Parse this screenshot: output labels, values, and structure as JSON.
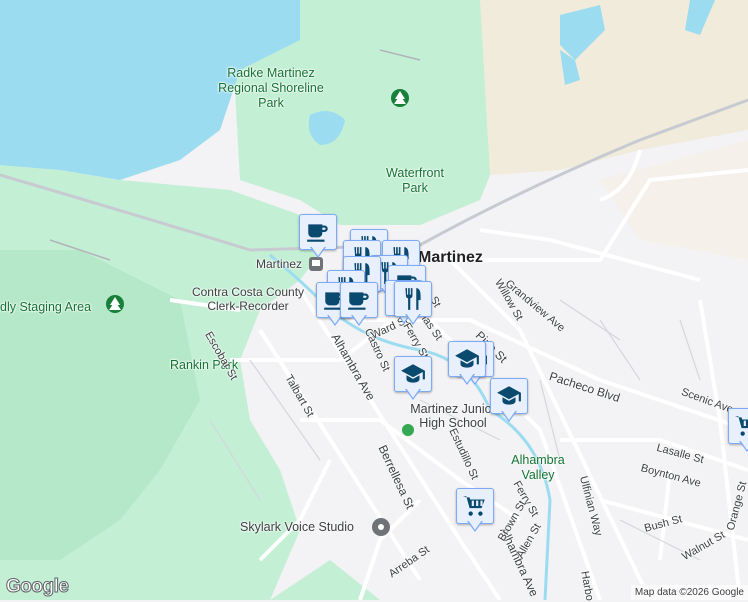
{
  "map": {
    "labels": {
      "radke_park": "Radke Martinez Regional Shoreline Park",
      "waterfront_park": "Waterfront Park",
      "martinez": "Martinez",
      "martinez_station": "Martinez",
      "clerk_recorder": "Contra Costa County Clerk-Recorder",
      "staging_area": "dly Staging Area",
      "rankin_park": "Rankin Park",
      "junior_high": "Martinez Junior High School",
      "alhambra_valley": "Alhambra Valley",
      "skylark": "Skylark Voice Studio"
    },
    "streets": {
      "escobar": "Escobar St",
      "talbart": "Talbart St",
      "alhambra_ave": "Alhambra Ave",
      "alhambra_ave_south": "Alhambra Ave",
      "castro": "Castro St",
      "ward": "Ward St",
      "ferry": "Ferry St",
      "ferry_south": "Ferry St",
      "las": "las St",
      "main": "St",
      "willow": "Willow St",
      "grandview": "Grandview Ave",
      "pine": "Pine St",
      "pacheco": "Pacheco Blvd",
      "scenic": "Scenic Ave",
      "lasalle": "Lasalle St",
      "boynton": "Boynton Ave",
      "orange": "Orange St",
      "estudillo": "Estudillo St",
      "ulfinian": "Ulfinian Way",
      "berrellesa": "Berrellesa St",
      "arreba": "Arreba St",
      "brown": "Brown St",
      "allen": "Allen St",
      "bush": "Bush St",
      "walnut": "Walnut St",
      "harbor": "Harbo"
    },
    "colors": {
      "water": "#9cdcf0",
      "park": "#c3efd4",
      "road": "#ffffff",
      "marker": "#e8f0fe",
      "icon": "#0b4a6f"
    }
  },
  "footer": {
    "logo": "Google",
    "attribution": "Map data ©2026 Google"
  }
}
